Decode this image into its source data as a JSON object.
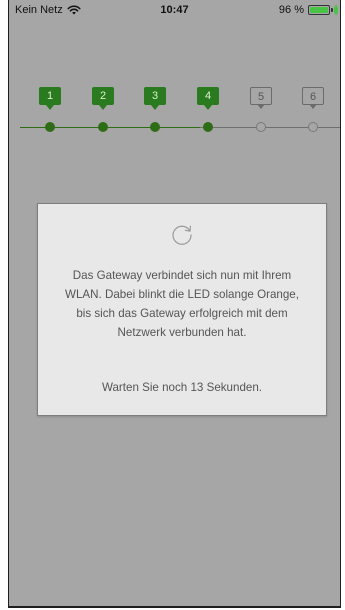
{
  "status_bar": {
    "carrier": "Kein Netz",
    "time": "10:47",
    "battery": "96 %",
    "wifi_icon": "wifi-icon"
  },
  "stepper": {
    "steps": [
      {
        "label": "1",
        "state": "done"
      },
      {
        "label": "2",
        "state": "done"
      },
      {
        "label": "3",
        "state": "done"
      },
      {
        "label": "4",
        "state": "done"
      },
      {
        "label": "5",
        "state": "todo"
      },
      {
        "label": "6",
        "state": "todo"
      }
    ],
    "done_color": "#2a7a1f",
    "todo_color": "#6b6b6b"
  },
  "modal": {
    "icon": "refresh-icon",
    "message": "Das Gateway verbindet sich nun mit Ihrem\nWLAN. Dabei blinkt die LED solange Orange,\nbis sich das Gateway erfolgreich mit dem\nNetzwerk verbunden hat.",
    "wait": "Warten Sie noch 13 Sekunden."
  },
  "colors": {
    "screen_background": "#a6a6a6",
    "modal_background": "#e8e8e8",
    "battery_green": "#47c346"
  }
}
